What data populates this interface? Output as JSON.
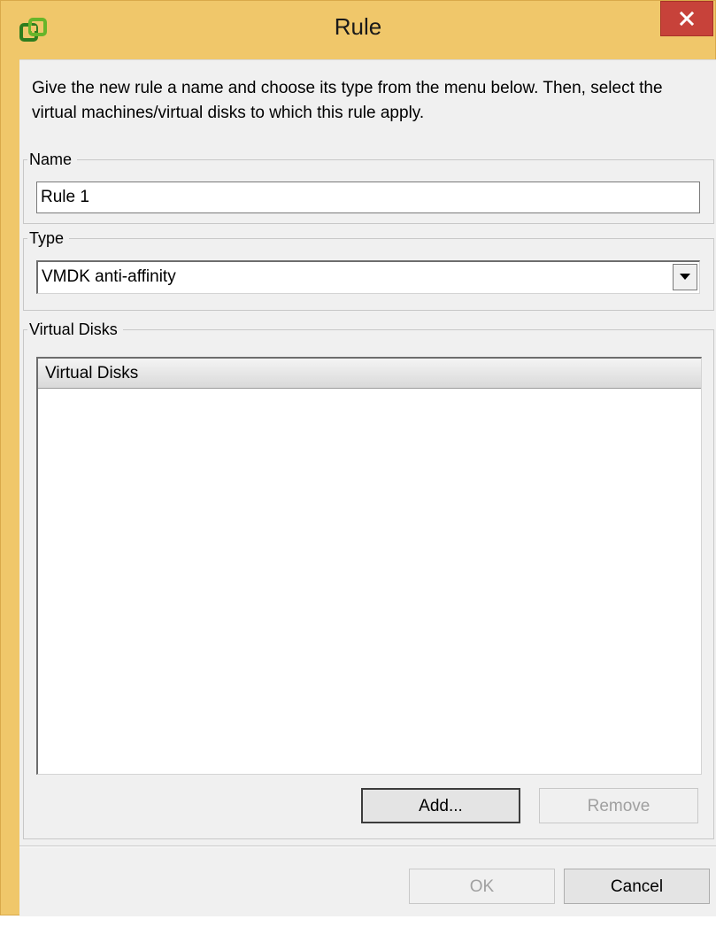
{
  "window": {
    "title": "Rule",
    "icon": "vsphere-app-icon",
    "frame_color": "#f0c76a",
    "close_color": "#c7423a"
  },
  "description": "Give the new rule a name and choose its type from the menu below. Then, select the virtual machines/virtual disks to which this rule apply.",
  "name_group": {
    "label": "Name",
    "value": "Rule 1"
  },
  "type_group": {
    "label": "Type",
    "selected": "VMDK anti-affinity"
  },
  "disks_group": {
    "label": "Virtual Disks",
    "column_header": "Virtual Disks",
    "add_label": "Add...",
    "remove_label": "Remove"
  },
  "footer": {
    "ok_label": "OK",
    "cancel_label": "Cancel"
  }
}
